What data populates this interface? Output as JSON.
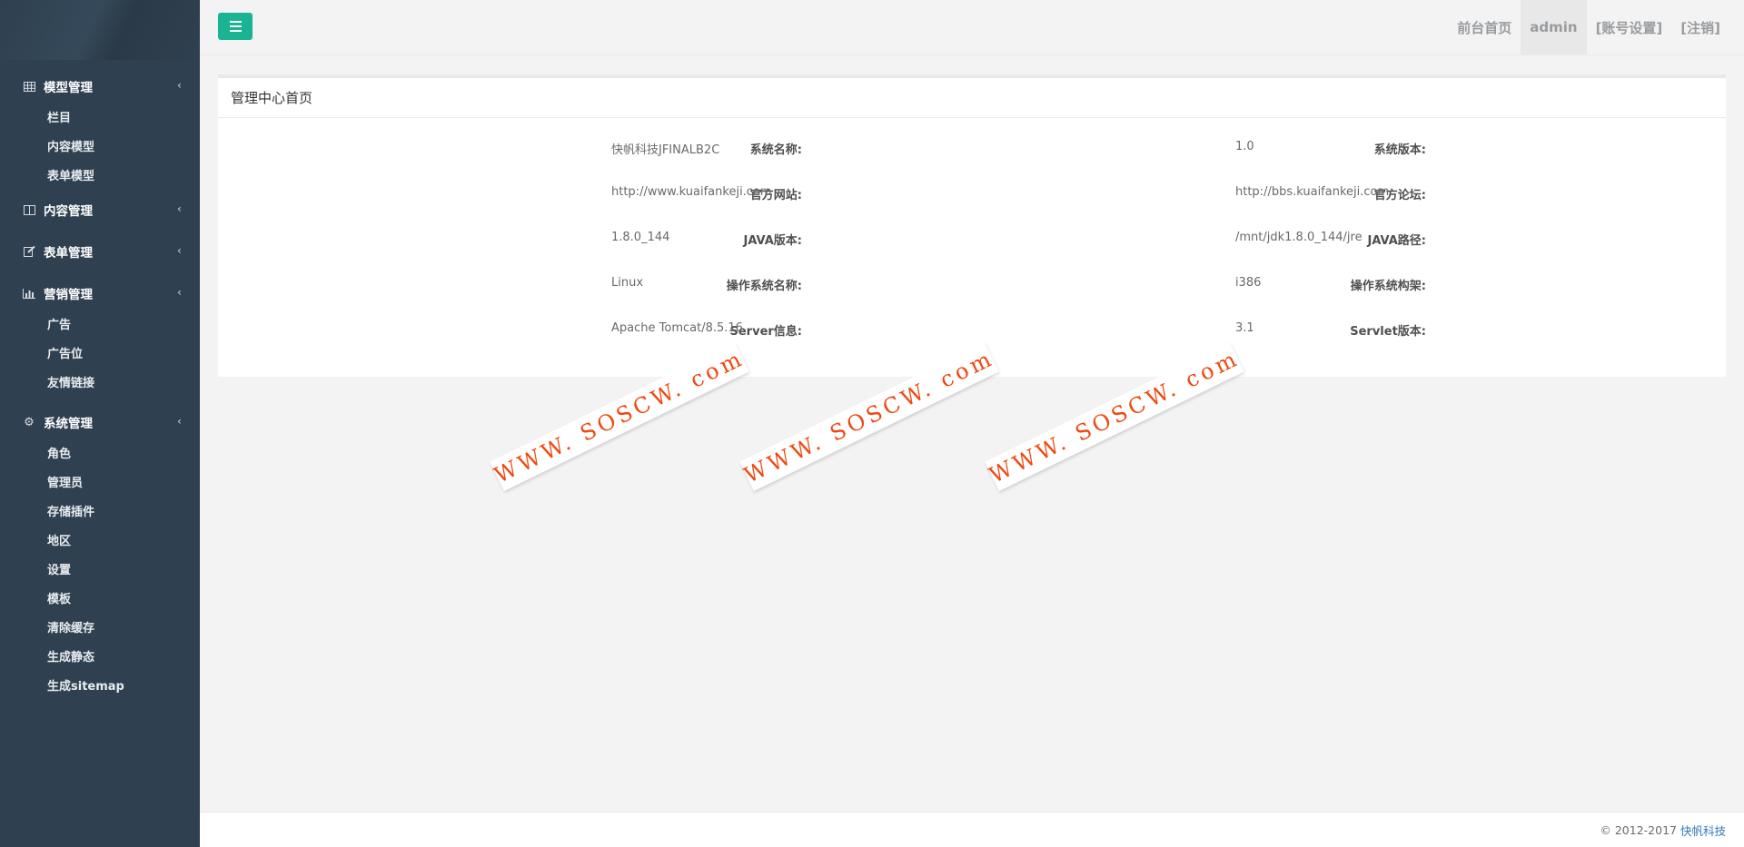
{
  "sidebar": {
    "groups": [
      {
        "label": "模型管理",
        "icon": "table-icon",
        "items": [
          "栏目",
          "内容模型",
          "表单模型"
        ]
      },
      {
        "label": "内容管理",
        "icon": "columns-icon",
        "items": []
      },
      {
        "label": "表单管理",
        "icon": "edit-icon",
        "items": []
      },
      {
        "label": "营销管理",
        "icon": "bar-chart-icon",
        "items": [
          "广告",
          "广告位",
          "友情链接"
        ]
      },
      {
        "label": "系统管理",
        "icon": "gear-icon",
        "items": [
          "角色",
          "管理员",
          "存储插件",
          "地区",
          "设置",
          "模板",
          "清除缓存",
          "生成静态",
          "生成sitemap"
        ]
      }
    ]
  },
  "topbar": {
    "links": [
      "前台首页",
      "admin",
      "[账号设置]",
      "[注销]"
    ]
  },
  "panel": {
    "title": "管理中心首页",
    "rows": [
      {
        "left_label": "系统名称:",
        "left_value": "快帆科技JFINALB2C",
        "right_label": "系统版本:",
        "right_value": "1.0"
      },
      {
        "left_label": "官方网站:",
        "left_value": "http://www.kuaifankeji.com",
        "right_label": "官方论坛:",
        "right_value": "http://bbs.kuaifankeji.com"
      },
      {
        "left_label": "JAVA版本:",
        "left_value": "1.8.0_144",
        "right_label": "JAVA路径:",
        "right_value": "/mnt/jdk1.8.0_144/jre"
      },
      {
        "left_label": "操作系统名称:",
        "left_value": "Linux",
        "right_label": "操作系统构架:",
        "right_value": "i386"
      },
      {
        "left_label": "Server信息:",
        "left_value": "Apache Tomcat/8.5.16",
        "right_label": "Servlet版本:",
        "right_value": "3.1"
      }
    ]
  },
  "watermark": "WWW. SOSCW. com",
  "footer": {
    "copyright": "© 2012-2017",
    "company": "快帆科技"
  },
  "colors": {
    "sidebar_bg": "#2f4050",
    "accent": "#1ab394",
    "watermark": "#ef4810",
    "link": "#337ab7"
  }
}
